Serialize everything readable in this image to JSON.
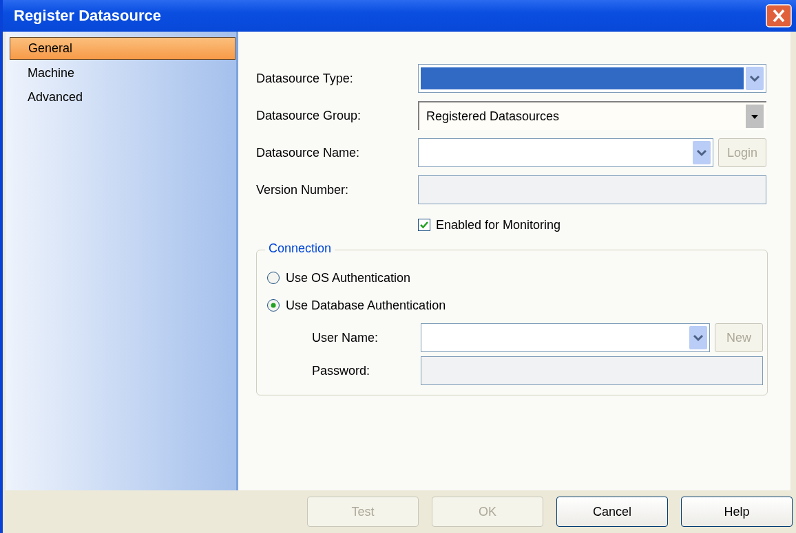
{
  "window": {
    "title": "Register Datasource"
  },
  "sidebar": {
    "items": [
      {
        "label": "General",
        "selected": true
      },
      {
        "label": "Machine",
        "selected": false
      },
      {
        "label": "Advanced",
        "selected": false
      }
    ]
  },
  "fields": [
    {
      "kind": "combo",
      "label": "Datasource Type:",
      "highlighted": true
    },
    {
      "kind": "dropdown",
      "label": "Datasource Group:",
      "value": "Registered Datasources"
    },
    {
      "kind": "combo",
      "label": "Datasource Name:",
      "button": {
        "label": "Login",
        "disabled": true
      }
    },
    {
      "kind": "text",
      "label": "Version Number:",
      "disabled": true
    }
  ],
  "monitoring": {
    "label": "Enabled for Monitoring",
    "checked": true
  },
  "connection": {
    "title": "Connection",
    "options": [
      {
        "label": "Use OS Authentication",
        "selected": false
      },
      {
        "label": "Use Database Authentication",
        "selected": true
      }
    ],
    "fields": [
      {
        "kind": "combo",
        "label": "User Name:",
        "button": {
          "label": "New",
          "disabled": true
        }
      },
      {
        "kind": "text",
        "label": "Password:",
        "disabled": true
      }
    ]
  },
  "buttons": [
    {
      "label": "Test",
      "disabled": true
    },
    {
      "label": "OK",
      "disabled": true
    },
    {
      "label": "Cancel",
      "disabled": false
    },
    {
      "label": "Help",
      "disabled": false
    }
  ]
}
